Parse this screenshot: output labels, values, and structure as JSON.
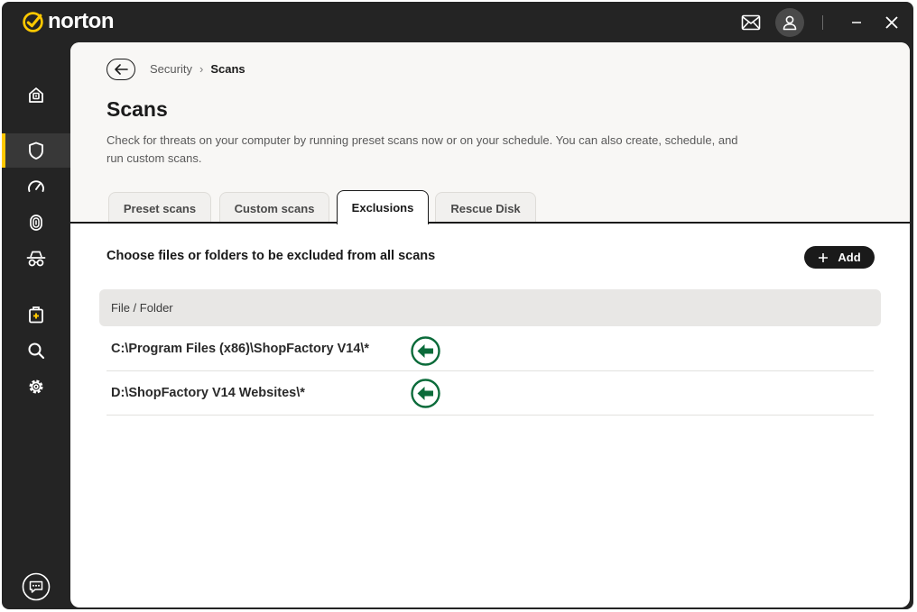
{
  "app": {
    "brand": "norton",
    "accent_color": "#ffc800",
    "restore_color": "#0b6b3a"
  },
  "titlebar": {
    "icons": [
      "mail-icon",
      "account-icon",
      "minimize-icon",
      "close-icon"
    ]
  },
  "sidebar": {
    "items": [
      {
        "icon": "home-icon",
        "active": false
      },
      {
        "icon": "shield-icon",
        "active": true
      },
      {
        "icon": "speedometer-icon",
        "active": false
      },
      {
        "icon": "fingerprint-icon",
        "active": false
      },
      {
        "icon": "incognito-icon",
        "active": false
      },
      {
        "icon": "medkit-icon",
        "active": false
      },
      {
        "icon": "search-icon",
        "active": false
      },
      {
        "icon": "gear-icon",
        "active": false
      }
    ],
    "footer_icon": "feedback-chat-icon"
  },
  "breadcrumb": {
    "parent": "Security",
    "current": "Scans"
  },
  "page": {
    "title": "Scans",
    "description": "Check for threats on your computer by running preset scans now or on your schedule. You can also create, schedule, and run custom scans."
  },
  "tabs": [
    {
      "label": "Preset scans",
      "active": false
    },
    {
      "label": "Custom scans",
      "active": false
    },
    {
      "label": "Exclusions",
      "active": true
    },
    {
      "label": "Rescue Disk",
      "active": false
    }
  ],
  "exclusions": {
    "section_title": "Choose files or folders to be excluded from all scans",
    "add_label": "Add",
    "column_header": "File / Folder",
    "rows": [
      {
        "path": "C:\\Program Files (x86)\\ShopFactory V14\\*"
      },
      {
        "path": "D:\\ShopFactory V14 Websites\\*"
      }
    ]
  }
}
